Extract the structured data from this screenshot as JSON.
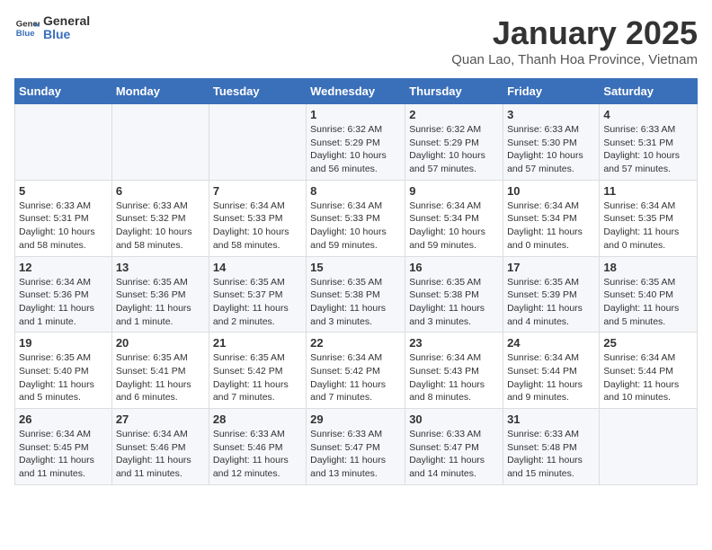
{
  "logo": {
    "text_general": "General",
    "text_blue": "Blue"
  },
  "title": "January 2025",
  "subtitle": "Quan Lao, Thanh Hoa Province, Vietnam",
  "headers": [
    "Sunday",
    "Monday",
    "Tuesday",
    "Wednesday",
    "Thursday",
    "Friday",
    "Saturday"
  ],
  "weeks": [
    [
      {
        "day": "",
        "info": ""
      },
      {
        "day": "",
        "info": ""
      },
      {
        "day": "",
        "info": ""
      },
      {
        "day": "1",
        "info": "Sunrise: 6:32 AM\nSunset: 5:29 PM\nDaylight: 10 hours\nand 56 minutes."
      },
      {
        "day": "2",
        "info": "Sunrise: 6:32 AM\nSunset: 5:29 PM\nDaylight: 10 hours\nand 57 minutes."
      },
      {
        "day": "3",
        "info": "Sunrise: 6:33 AM\nSunset: 5:30 PM\nDaylight: 10 hours\nand 57 minutes."
      },
      {
        "day": "4",
        "info": "Sunrise: 6:33 AM\nSunset: 5:31 PM\nDaylight: 10 hours\nand 57 minutes."
      }
    ],
    [
      {
        "day": "5",
        "info": "Sunrise: 6:33 AM\nSunset: 5:31 PM\nDaylight: 10 hours\nand 58 minutes."
      },
      {
        "day": "6",
        "info": "Sunrise: 6:33 AM\nSunset: 5:32 PM\nDaylight: 10 hours\nand 58 minutes."
      },
      {
        "day": "7",
        "info": "Sunrise: 6:34 AM\nSunset: 5:33 PM\nDaylight: 10 hours\nand 58 minutes."
      },
      {
        "day": "8",
        "info": "Sunrise: 6:34 AM\nSunset: 5:33 PM\nDaylight: 10 hours\nand 59 minutes."
      },
      {
        "day": "9",
        "info": "Sunrise: 6:34 AM\nSunset: 5:34 PM\nDaylight: 10 hours\nand 59 minutes."
      },
      {
        "day": "10",
        "info": "Sunrise: 6:34 AM\nSunset: 5:34 PM\nDaylight: 11 hours\nand 0 minutes."
      },
      {
        "day": "11",
        "info": "Sunrise: 6:34 AM\nSunset: 5:35 PM\nDaylight: 11 hours\nand 0 minutes."
      }
    ],
    [
      {
        "day": "12",
        "info": "Sunrise: 6:34 AM\nSunset: 5:36 PM\nDaylight: 11 hours\nand 1 minute."
      },
      {
        "day": "13",
        "info": "Sunrise: 6:35 AM\nSunset: 5:36 PM\nDaylight: 11 hours\nand 1 minute."
      },
      {
        "day": "14",
        "info": "Sunrise: 6:35 AM\nSunset: 5:37 PM\nDaylight: 11 hours\nand 2 minutes."
      },
      {
        "day": "15",
        "info": "Sunrise: 6:35 AM\nSunset: 5:38 PM\nDaylight: 11 hours\nand 3 minutes."
      },
      {
        "day": "16",
        "info": "Sunrise: 6:35 AM\nSunset: 5:38 PM\nDaylight: 11 hours\nand 3 minutes."
      },
      {
        "day": "17",
        "info": "Sunrise: 6:35 AM\nSunset: 5:39 PM\nDaylight: 11 hours\nand 4 minutes."
      },
      {
        "day": "18",
        "info": "Sunrise: 6:35 AM\nSunset: 5:40 PM\nDaylight: 11 hours\nand 5 minutes."
      }
    ],
    [
      {
        "day": "19",
        "info": "Sunrise: 6:35 AM\nSunset: 5:40 PM\nDaylight: 11 hours\nand 5 minutes."
      },
      {
        "day": "20",
        "info": "Sunrise: 6:35 AM\nSunset: 5:41 PM\nDaylight: 11 hours\nand 6 minutes."
      },
      {
        "day": "21",
        "info": "Sunrise: 6:35 AM\nSunset: 5:42 PM\nDaylight: 11 hours\nand 7 minutes."
      },
      {
        "day": "22",
        "info": "Sunrise: 6:34 AM\nSunset: 5:42 PM\nDaylight: 11 hours\nand 7 minutes."
      },
      {
        "day": "23",
        "info": "Sunrise: 6:34 AM\nSunset: 5:43 PM\nDaylight: 11 hours\nand 8 minutes."
      },
      {
        "day": "24",
        "info": "Sunrise: 6:34 AM\nSunset: 5:44 PM\nDaylight: 11 hours\nand 9 minutes."
      },
      {
        "day": "25",
        "info": "Sunrise: 6:34 AM\nSunset: 5:44 PM\nDaylight: 11 hours\nand 10 minutes."
      }
    ],
    [
      {
        "day": "26",
        "info": "Sunrise: 6:34 AM\nSunset: 5:45 PM\nDaylight: 11 hours\nand 11 minutes."
      },
      {
        "day": "27",
        "info": "Sunrise: 6:34 AM\nSunset: 5:46 PM\nDaylight: 11 hours\nand 11 minutes."
      },
      {
        "day": "28",
        "info": "Sunrise: 6:33 AM\nSunset: 5:46 PM\nDaylight: 11 hours\nand 12 minutes."
      },
      {
        "day": "29",
        "info": "Sunrise: 6:33 AM\nSunset: 5:47 PM\nDaylight: 11 hours\nand 13 minutes."
      },
      {
        "day": "30",
        "info": "Sunrise: 6:33 AM\nSunset: 5:47 PM\nDaylight: 11 hours\nand 14 minutes."
      },
      {
        "day": "31",
        "info": "Sunrise: 6:33 AM\nSunset: 5:48 PM\nDaylight: 11 hours\nand 15 minutes."
      },
      {
        "day": "",
        "info": ""
      }
    ]
  ]
}
